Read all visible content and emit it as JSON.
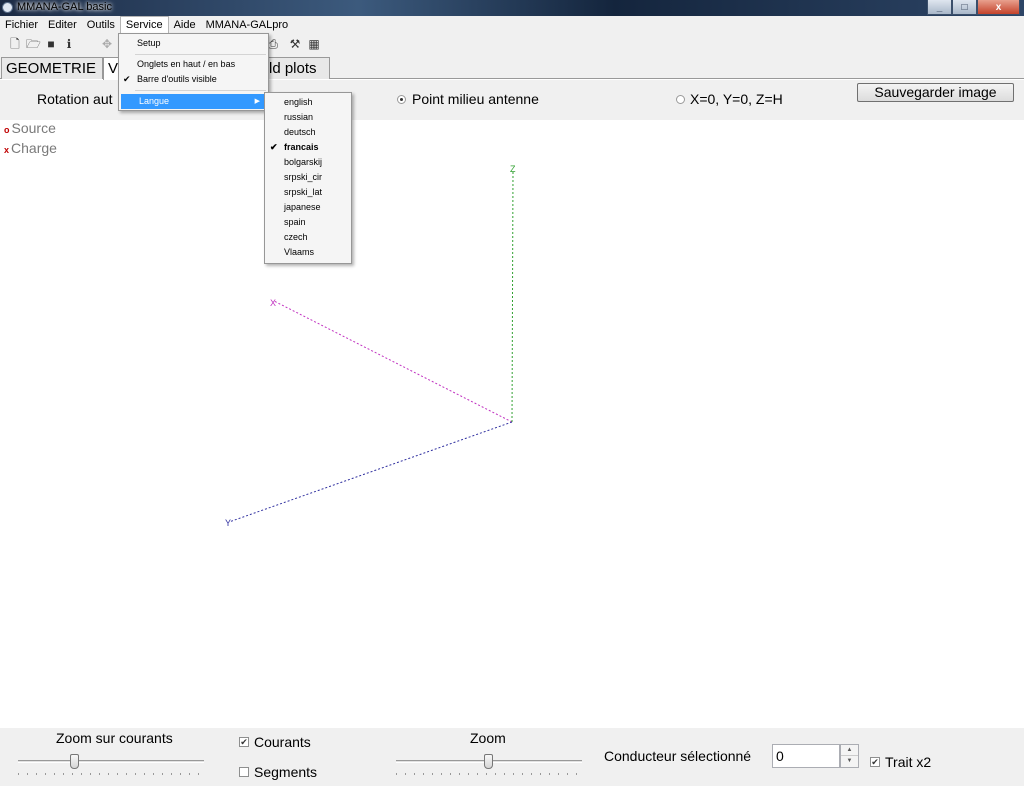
{
  "window": {
    "title": "MMANA-GAL basic",
    "minimize": "_",
    "restore": "□",
    "close": "x"
  },
  "menubar": [
    "Fichier",
    "Editer",
    "Outils",
    "Service",
    "Aide",
    "MMANA-GALpro"
  ],
  "toolbar_icons": [
    "new-file-icon",
    "open-folder-icon",
    "save-icon",
    "info-icon",
    "move-icon",
    "print-icon",
    "tools-icon",
    "calculator-icon"
  ],
  "tabs": {
    "geometrie": "GEOMETRIE",
    "view": "V",
    "field_plots": "ld plots"
  },
  "controls": {
    "rotation_label": "Rotation aut",
    "option_midpoint": "Point milieu antenne",
    "option_origin": "X=0, Y=0, Z=H",
    "save_image": "Sauvegarder image"
  },
  "legend": {
    "source_mark": "o",
    "source": "Source",
    "charge_mark": "x",
    "charge": "Charge"
  },
  "axes": {
    "x": "X",
    "y": "Y",
    "z": "Z"
  },
  "colors": {
    "x_axis": "#c030c0",
    "y_axis": "#3030a0",
    "z_axis": "#30a030",
    "menu_highlight": "#3399ff"
  },
  "bottom": {
    "zoom_currents": "Zoom sur courants",
    "zoom_currents_level": 0.3,
    "courants": "Courants",
    "courants_checked": true,
    "segments": "Segments",
    "segments_checked": false,
    "zoom": "Zoom",
    "zoom_level": 0.5,
    "selected_conductor_label": "Conducteur sélectionné",
    "selected_conductor_value": "0",
    "trait_x2": "Trait x2",
    "trait_x2_checked": true
  },
  "service_menu": {
    "setup": "Setup",
    "tabs_position": "Onglets en haut / en bas",
    "toolbar_visible": "Barre d'outils visible",
    "langue": "Langue"
  },
  "language_menu": {
    "items": [
      "english",
      "russian",
      "deutsch",
      "francais",
      "bolgarskij",
      "srpski_cir",
      "srpski_lat",
      "japanese",
      "spain",
      "czech",
      "Vlaams"
    ],
    "selected": "francais"
  }
}
